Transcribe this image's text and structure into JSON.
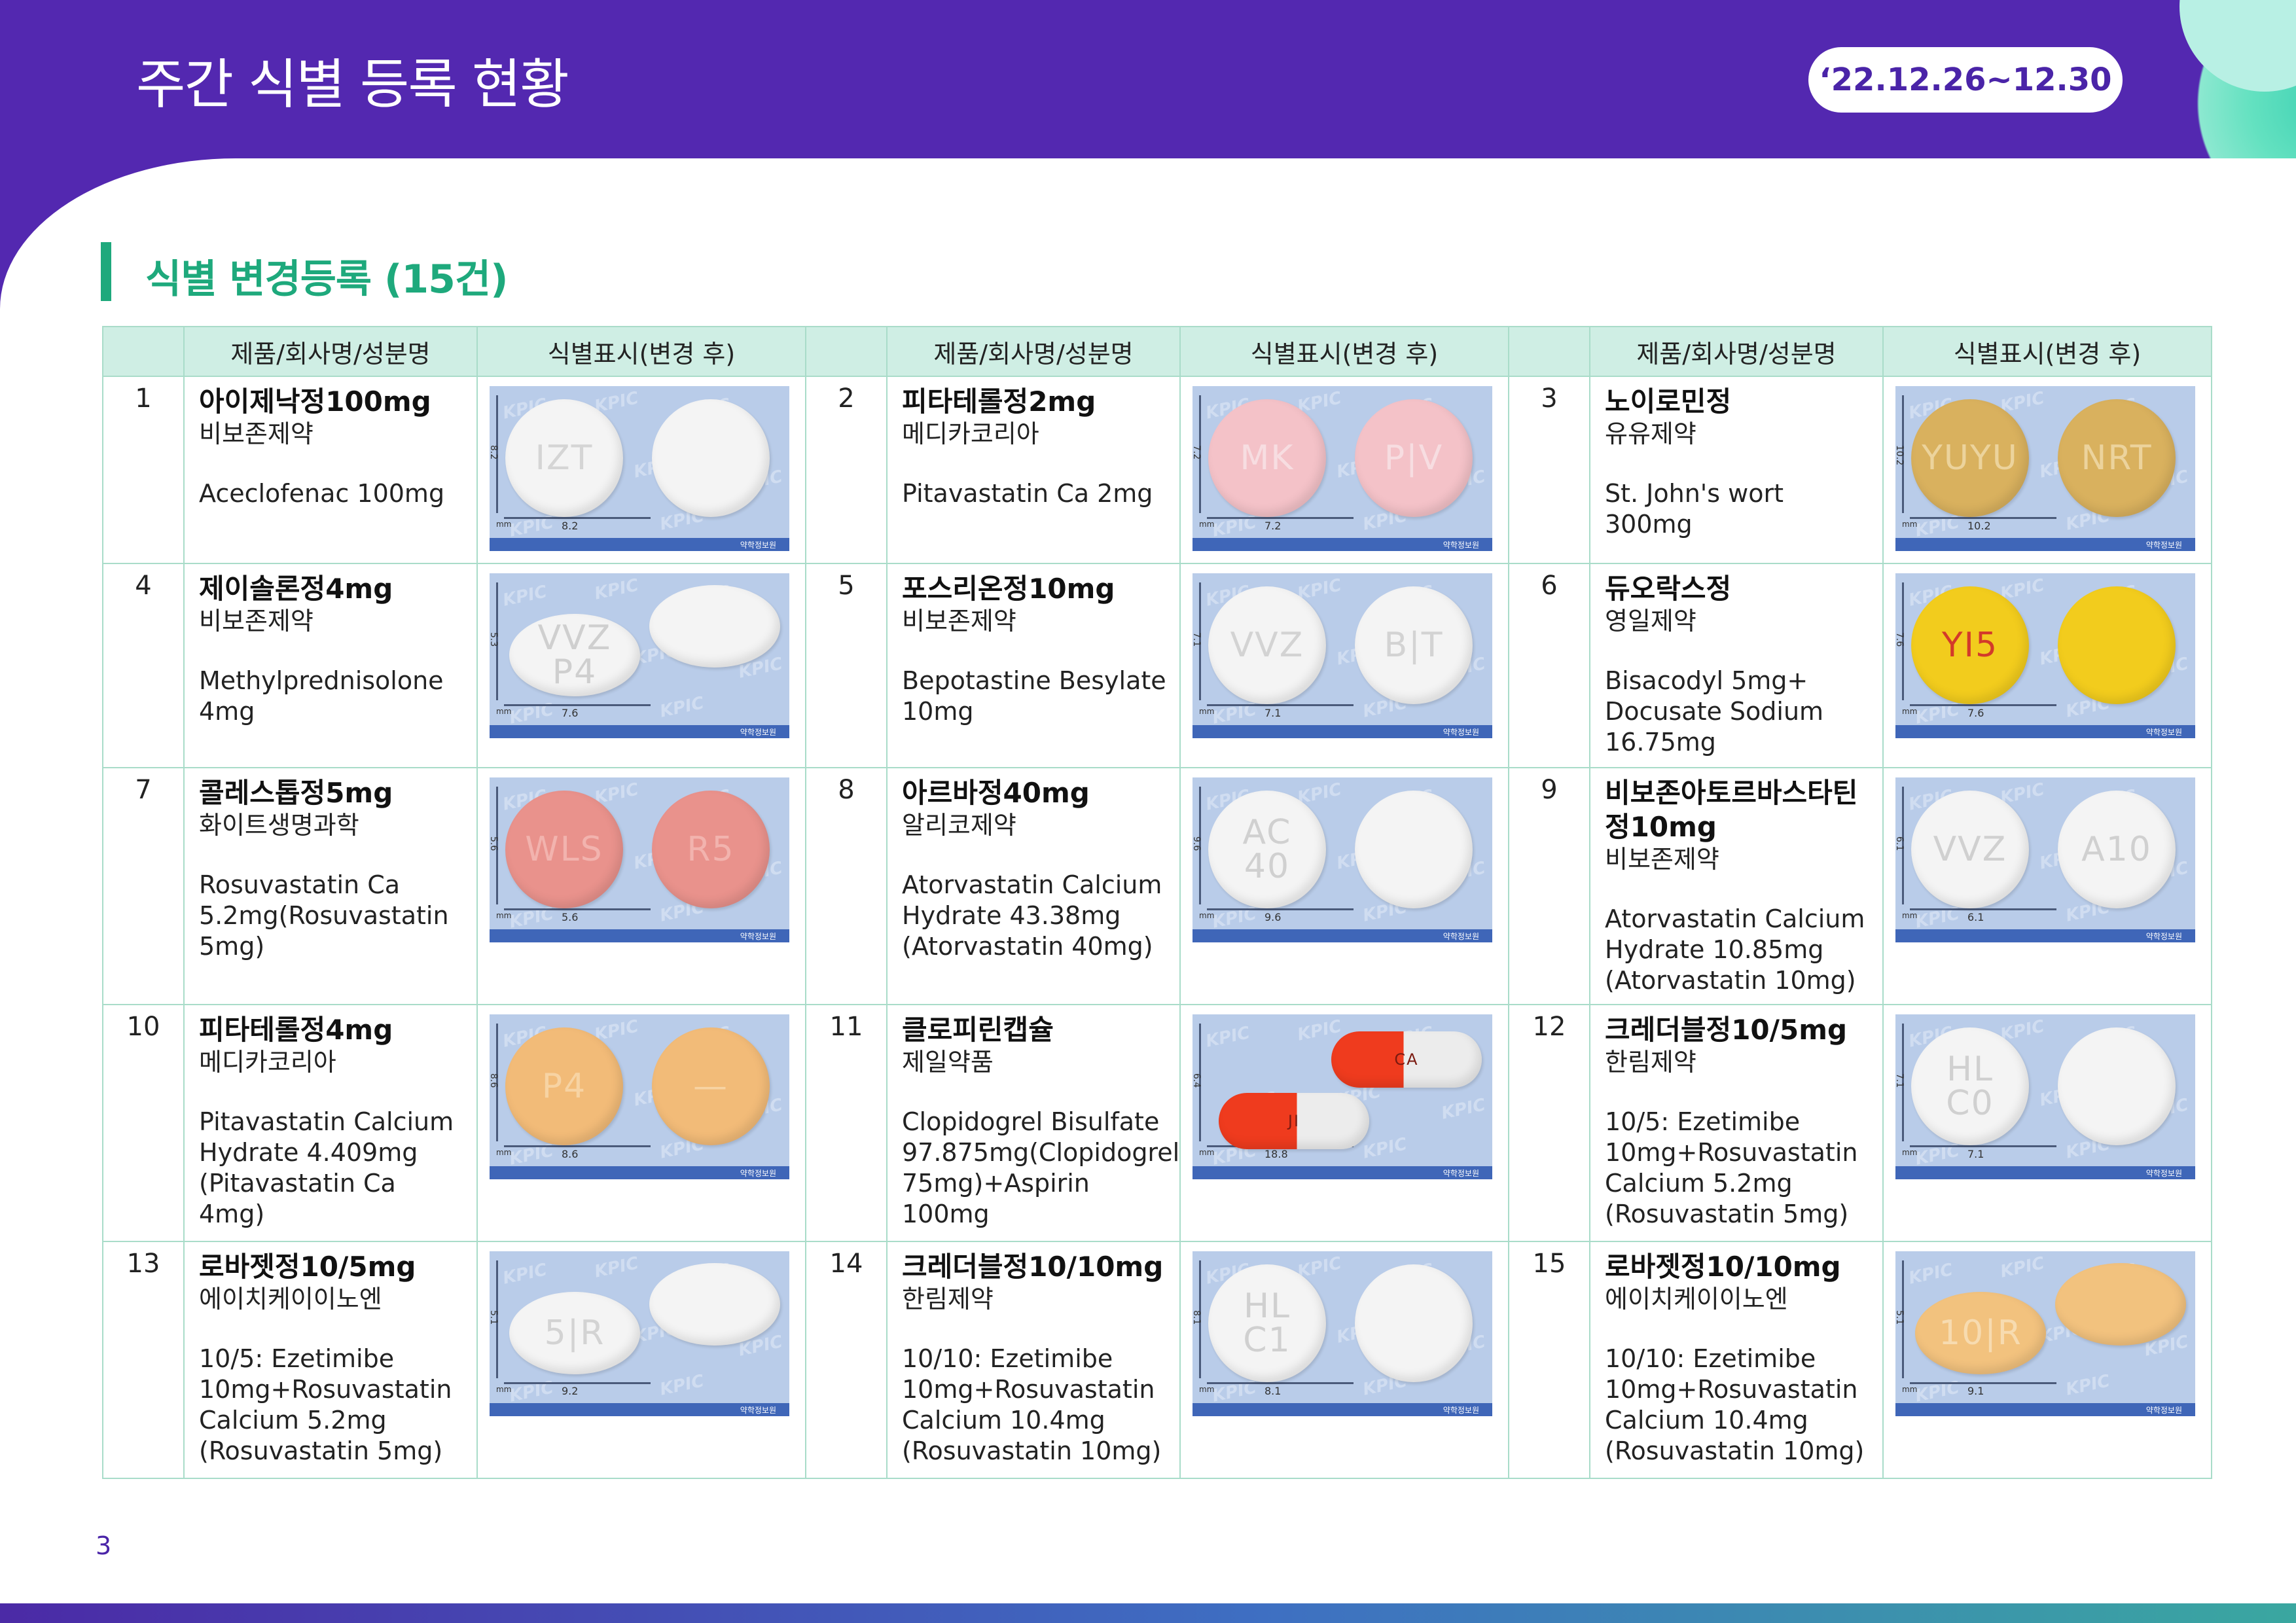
{
  "header": {
    "title": "주간 식별 등록 현황",
    "date_range": "‘22.12.26~12.30"
  },
  "section": {
    "title": "식별  변경등록  (15건)"
  },
  "table_headers": [
    "",
    "제품/회사명/성분명",
    "식별표시(변경 후)",
    "",
    "제품/회사명/성분명",
    "식별표시(변경 후)",
    "",
    "제품/회사명/성분명",
    "식별표시(변경 후)"
  ],
  "photo_watermark": "KPIC",
  "photo_mm": "mm",
  "photo_footer": "약학정보원",
  "items": [
    {
      "no": "1",
      "name": "아이제낙정100mg",
      "company": "비보존제약",
      "ingredient": "Aceclofenac  100mg",
      "size_v": "8.2",
      "size_h": "8.2",
      "front": "IZT",
      "back": "",
      "color": "#f4f4f4",
      "text_color": "#d5d5d5",
      "shape": "round"
    },
    {
      "no": "2",
      "name": "피타테롤정2mg",
      "company": "메디카코리아",
      "ingredient": "Pitavastatin  Ca  2mg",
      "size_v": "7.2",
      "size_h": "7.2",
      "front": "MK",
      "back": "P|V",
      "color": "#f4c2c8",
      "text_color": "#f7dde1",
      "shape": "round"
    },
    {
      "no": "3",
      "name": "노이로민정",
      "company": "유유제약",
      "ingredient": "St.  John's  wort\n300mg",
      "size_v": "10.2",
      "size_h": "10.2",
      "front": "YUYU",
      "back": "NRT",
      "color": "#d9b15e",
      "text_color": "#ecd39c",
      "shape": "round"
    },
    {
      "no": "4",
      "name": "제이솔론정4mg",
      "company": "비보존제약",
      "ingredient": "Methylprednisolone\n4mg",
      "size_v": "5.3",
      "size_h": "7.6",
      "front": "VVZ\nP4",
      "back": "",
      "color": "#f4f4f4",
      "text_color": "#cfcfcf",
      "shape": "oval"
    },
    {
      "no": "5",
      "name": "포스리온정10mg",
      "company": "비보존제약",
      "ingredient": "Bepotastine  Besylate\n10mg",
      "size_v": "7.1",
      "size_h": "7.1",
      "front": "VVZ",
      "back": "B|T",
      "color": "#f4f4f4",
      "text_color": "#d3d3d3",
      "shape": "round"
    },
    {
      "no": "6",
      "name": "듀오락스정",
      "company": "영일제약",
      "ingredient": "Bisacodyl  5mg+\nDocusate  Sodium\n16.75mg",
      "size_v": "7.6",
      "size_h": "7.6",
      "front": "YI5",
      "back": "",
      "color": "#f2cc1d",
      "text_color": "#d33a2a",
      "shape": "round"
    },
    {
      "no": "7",
      "name": "콜레스톱정5mg",
      "company": "화이트생명과학",
      "ingredient": "Rosuvastatin  Ca\n5.2mg(Rosuvastatin\n5mg)",
      "size_v": "5.6",
      "size_h": "5.6",
      "front": "WLS",
      "back": "R5",
      "color": "#e9928c",
      "text_color": "#f2b3ae",
      "shape": "round"
    },
    {
      "no": "8",
      "name": "아르바정40mg",
      "company": "알리코제약",
      "ingredient": "Atorvastatin  Calcium\nHydrate  43.38mg\n(Atorvastatin  40mg)",
      "size_v": "9.6",
      "size_h": "9.6",
      "front": "AC\n40",
      "back": "",
      "color": "#f4f4f4",
      "text_color": "#d0d0d0",
      "shape": "round"
    },
    {
      "no": "9",
      "name": "비보존아토르바스타틴\n정10mg",
      "company": "비보존제약",
      "ingredient": "Atorvastatin  Calcium\nHydrate  10.85mg\n(Atorvastatin  10mg)",
      "size_v": "6.1",
      "size_h": "6.1",
      "front": "VVZ",
      "back": "A10",
      "color": "#f4f4f4",
      "text_color": "#d0d0d0",
      "shape": "round"
    },
    {
      "no": "10",
      "name": "피타테롤정4mg",
      "company": "메디카코리아",
      "ingredient": "Pitavastatin  Calcium\nHydrate  4.409mg\n(Pitavastatin  Ca  4mg)",
      "size_v": "8.6",
      "size_h": "8.6",
      "front": "P4",
      "back": "—",
      "color": "#f2bb78",
      "text_color": "#f7d3a3",
      "shape": "round"
    },
    {
      "no": "11",
      "name": "클로피린캡슐",
      "company": "제일약품",
      "ingredient": "Clopidogrel  Bisulfate\n97.875mg(Clopidogrel\n75mg)+Aspirin  100mg",
      "size_v": "6.4",
      "size_h": "18.8",
      "front": "JI",
      "back": "CA",
      "color": "#ef3b1e",
      "text_color": "#7a1a10",
      "shape": "capsule"
    },
    {
      "no": "12",
      "name": "크레더블정10/5mg",
      "company": "한림제약",
      "ingredient": "10/5:  Ezetimibe\n10mg+Rosuvastatin\nCalcium  5.2mg\n(Rosuvastatin  5mg)",
      "size_v": "7.1",
      "size_h": "7.1",
      "front": "HL\nC0",
      "back": "",
      "color": "#f4f4f4",
      "text_color": "#d0d0d0",
      "shape": "round"
    },
    {
      "no": "13",
      "name": "로바젯정10/5mg",
      "company": "에이치케이이노엔",
      "ingredient": "10/5:  Ezetimibe\n10mg+Rosuvastatin\nCalcium  5.2mg\n(Rosuvastatin  5mg)",
      "size_v": "5.1",
      "size_h": "9.2",
      "front": "5|R",
      "back": "",
      "color": "#f4f4f4",
      "text_color": "#d3d3d3",
      "shape": "oval"
    },
    {
      "no": "14",
      "name": "크레더블정10/10mg",
      "company": "한림제약",
      "ingredient": "10/10:  Ezetimibe\n10mg+Rosuvastatin\nCalcium  10.4mg\n(Rosuvastatin  10mg)",
      "size_v": "8.1",
      "size_h": "8.1",
      "front": "HL\nC1",
      "back": "",
      "color": "#f4f4f4",
      "text_color": "#d0d0d0",
      "shape": "round"
    },
    {
      "no": "15",
      "name": "로바젯정10/10mg",
      "company": "에이치케이이노엔",
      "ingredient": "10/10:  Ezetimibe\n10mg+Rosuvastatin\nCalcium  10.4mg\n(Rosuvastatin  10mg)",
      "size_v": "5.1",
      "size_h": "9.1",
      "front": "10|R",
      "back": "",
      "color": "#f2c27e",
      "text_color": "#f7dbb0",
      "shape": "oval"
    }
  ],
  "page_number": "3",
  "colors": {
    "header_bg": "#5328b0",
    "accent_green": "#1ea97c",
    "table_header_bg": "#cfeee4",
    "table_border": "#a9dcc9"
  }
}
